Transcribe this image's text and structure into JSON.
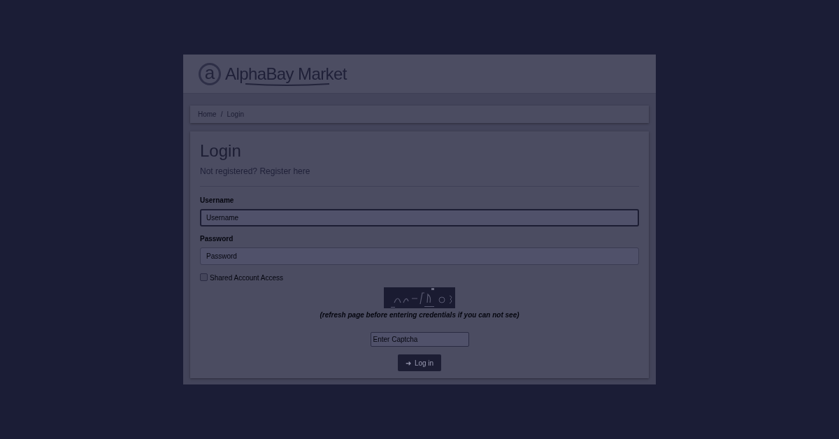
{
  "header": {
    "logo_letter": "a",
    "logo_text": "AlphaBay Market"
  },
  "breadcrumb": [
    "Home",
    "/",
    "Login"
  ],
  "login": {
    "title": "Login",
    "register_prompt": "Not registered? Register here",
    "fields": [
      {
        "label": "Username",
        "placeholder": "Username",
        "focused": true
      },
      {
        "label": "Password",
        "placeholder": "Password",
        "focused": false
      }
    ],
    "shared_access": {
      "label": "Shared Account Access",
      "checked": false
    },
    "captcha": {
      "kind": "picture",
      "hint": "(refresh page before entering credentials if you can not see)",
      "placeholder": "Enter Captcha"
    },
    "submit": {
      "icon": "➜",
      "label": "Log in"
    }
  }
}
